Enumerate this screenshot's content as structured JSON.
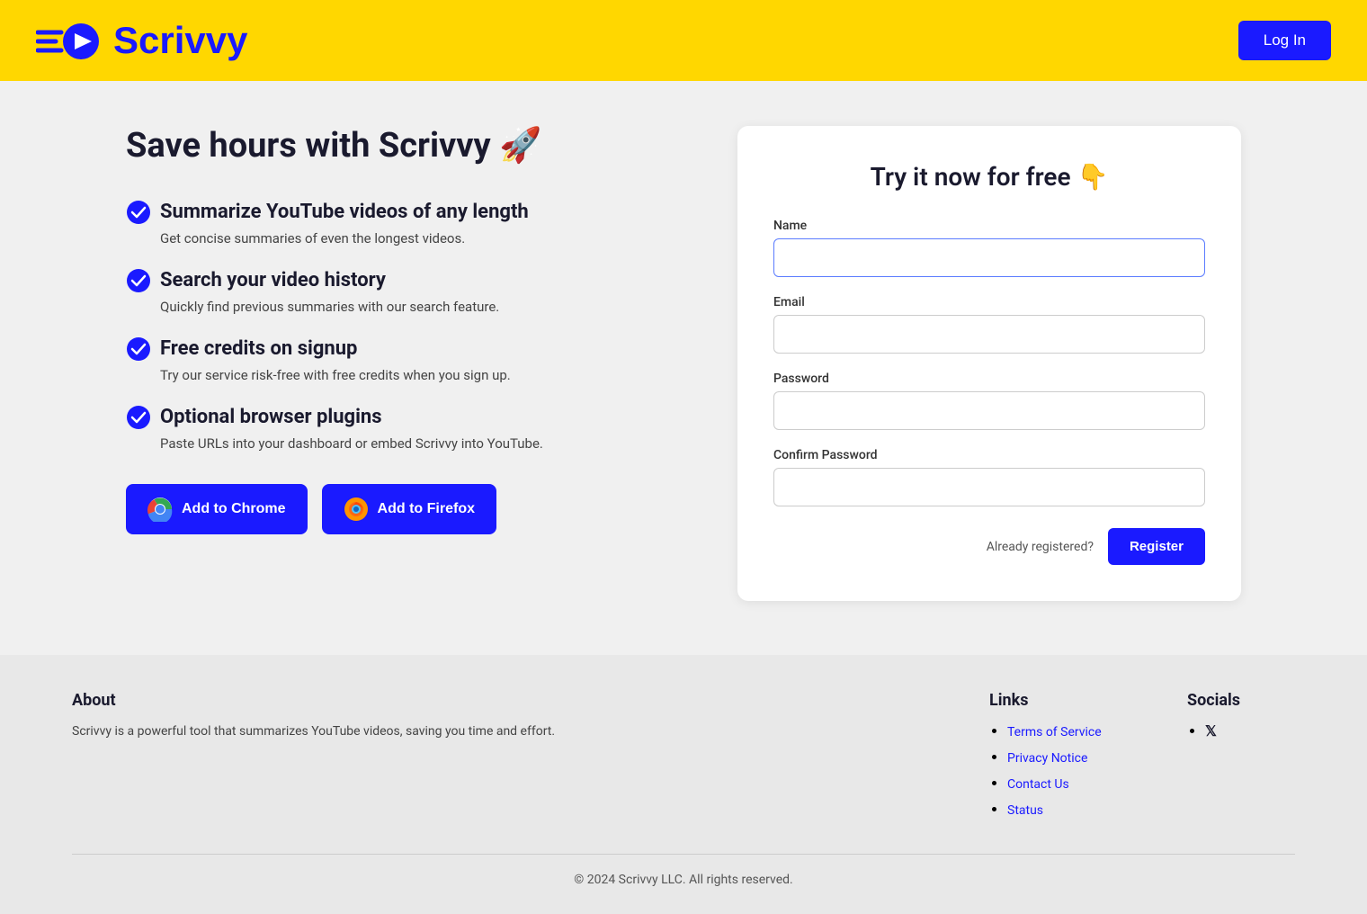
{
  "header": {
    "logo_text": "Scrivvy",
    "login_label": "Log In"
  },
  "hero": {
    "title": "Save hours with Scrivvy 🚀",
    "features": [
      {
        "heading": "Summarize YouTube videos of any length",
        "description": "Get concise summaries of even the longest videos."
      },
      {
        "heading": "Search your video history",
        "description": "Quickly find previous summaries with our search feature."
      },
      {
        "heading": "Free credits on signup",
        "description": "Try our service risk-free with free credits when you sign up."
      },
      {
        "heading": "Optional browser plugins",
        "description": "Paste URLs into your dashboard or embed Scrivvy into YouTube."
      }
    ],
    "chrome_button": "Add to Chrome",
    "firefox_button": "Add to Firefox"
  },
  "form": {
    "title": "Try it now for free 👇",
    "name_label": "Name",
    "name_placeholder": "",
    "email_label": "Email",
    "email_placeholder": "",
    "password_label": "Password",
    "password_placeholder": "",
    "confirm_label": "Confirm Password",
    "confirm_placeholder": "",
    "already_text": "Already registered?",
    "register_label": "Register"
  },
  "footer": {
    "about_title": "About",
    "about_text": "Scrivvy is a powerful tool that summarizes YouTube videos, saving you time and effort.",
    "links_title": "Links",
    "links": [
      {
        "label": "Terms of Service",
        "href": "#"
      },
      {
        "label": "Privacy Notice",
        "href": "#"
      },
      {
        "label": "Contact Us",
        "href": "#"
      },
      {
        "label": "Status",
        "href": "#"
      }
    ],
    "socials_title": "Socials",
    "copyright": "© 2024 Scrivvy LLC. All rights reserved."
  }
}
